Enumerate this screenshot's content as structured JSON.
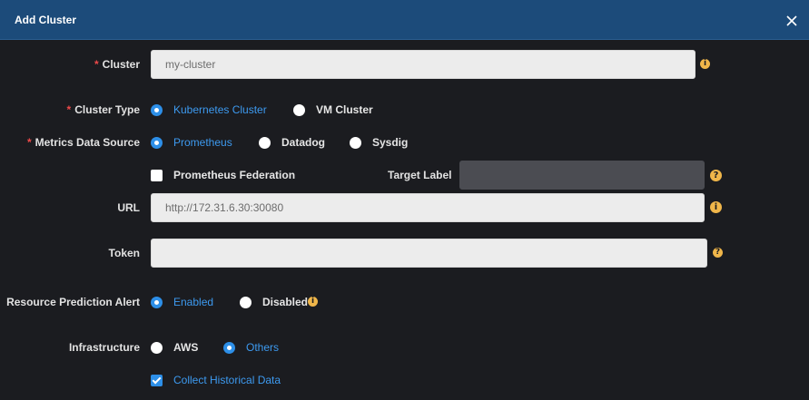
{
  "dialog": {
    "title": "Add Cluster",
    "close_icon": "close-icon"
  },
  "colors": {
    "header": "#1c4b7a",
    "background": "#1b1c20",
    "accent": "#2d8fe8",
    "required": "#ef4a4a",
    "info": "#f0b64a"
  },
  "cluster": {
    "required_mark": "*",
    "label": "Cluster",
    "value": "my-cluster"
  },
  "cluster_type": {
    "required_mark": "*",
    "label": "Cluster Type",
    "options": [
      {
        "label": "Kubernetes Cluster",
        "selected": true
      },
      {
        "label": "VM Cluster",
        "selected": false
      }
    ]
  },
  "metrics_source": {
    "required_mark": "*",
    "label": "Metrics Data Source",
    "options": [
      {
        "label": "Prometheus",
        "selected": true
      },
      {
        "label": "Datadog",
        "selected": false
      },
      {
        "label": "Sysdig",
        "selected": false
      }
    ]
  },
  "federation": {
    "label": "Prometheus Federation",
    "checked": false,
    "target_label": "Target Label",
    "target_value": ""
  },
  "url": {
    "label": "URL",
    "value": "http://172.31.6.30:30080"
  },
  "token": {
    "label": "Token",
    "value": ""
  },
  "prediction_alert": {
    "label": "Resource Prediction Alert",
    "options": [
      {
        "label": "Enabled",
        "selected": true
      },
      {
        "label": "Disabled",
        "selected": false
      }
    ]
  },
  "infrastructure": {
    "label": "Infrastructure",
    "options": [
      {
        "label": "AWS",
        "selected": false
      },
      {
        "label": "Others",
        "selected": true
      }
    ]
  },
  "historical": {
    "label": "Collect Historical Data",
    "checked": true
  },
  "info_glyph": "i",
  "help_glyph": "?"
}
